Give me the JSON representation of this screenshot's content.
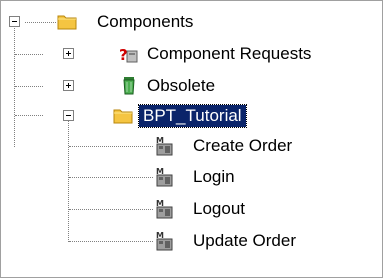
{
  "tree": {
    "root": {
      "label": "Components",
      "expanded": true,
      "icon": "folder-icon",
      "children": [
        {
          "label": "Component Requests",
          "icon": "component-request-icon",
          "expanded": false
        },
        {
          "label": "Obsolete",
          "icon": "recycle-bin-icon",
          "expanded": false
        },
        {
          "label": "BPT_Tutorial",
          "icon": "folder-icon",
          "expanded": true,
          "selected": true,
          "children": [
            {
              "label": "Create Order",
              "icon": "manual-component-icon"
            },
            {
              "label": "Login",
              "icon": "manual-component-icon"
            },
            {
              "label": "Logout",
              "icon": "manual-component-icon"
            },
            {
              "label": "Update Order",
              "icon": "manual-component-icon"
            }
          ]
        }
      ]
    }
  },
  "colors": {
    "selection_bg": "#0a246a",
    "folder": "#f5c542",
    "recycle": "#4caf50"
  }
}
